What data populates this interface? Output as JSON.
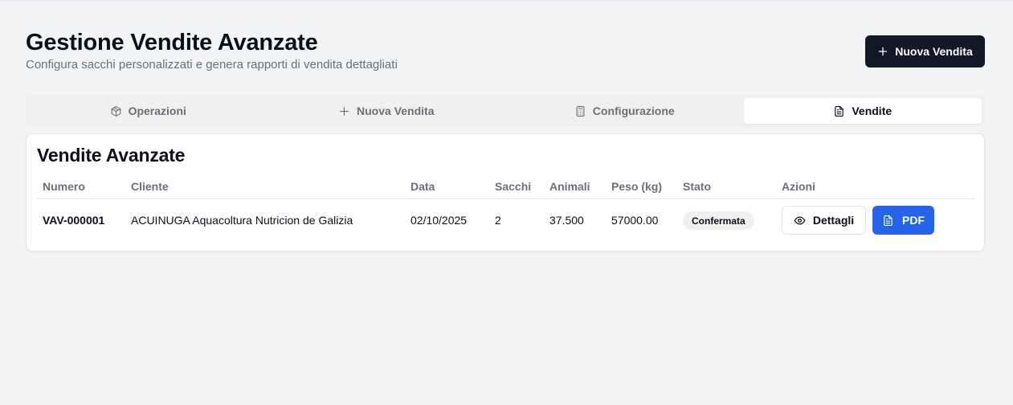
{
  "header": {
    "title": "Gestione Vendite Avanzate",
    "subtitle": "Configura sacchi personalizzati e genera rapporti di vendita dettagliati",
    "new_sale_label": "Nuova Vendita"
  },
  "tabs": [
    {
      "label": "Operazioni",
      "icon": "package-icon",
      "active": false
    },
    {
      "label": "Nuova Vendita",
      "icon": "plus-icon",
      "active": false
    },
    {
      "label": "Configurazione",
      "icon": "calculator-icon",
      "active": false
    },
    {
      "label": "Vendite",
      "icon": "file-text-icon",
      "active": true
    }
  ],
  "sales": {
    "title": "Vendite Avanzate",
    "columns": [
      "Numero",
      "Cliente",
      "Data",
      "Sacchi",
      "Animali",
      "Peso (kg)",
      "Stato",
      "Azioni"
    ],
    "rows": [
      {
        "numero": "VAV-000001",
        "cliente": "ACUINUGA Aquacoltura Nutricion de Galizia",
        "data": "02/10/2025",
        "sacchi": "2",
        "animali": "37.500",
        "peso": "57000.00",
        "stato": "Confermata",
        "details_label": "Dettagli",
        "pdf_label": "PDF"
      }
    ]
  },
  "colors": {
    "primary_dark": "#111827",
    "pdf_blue": "#2563eb",
    "background": "#f3f4f6"
  }
}
